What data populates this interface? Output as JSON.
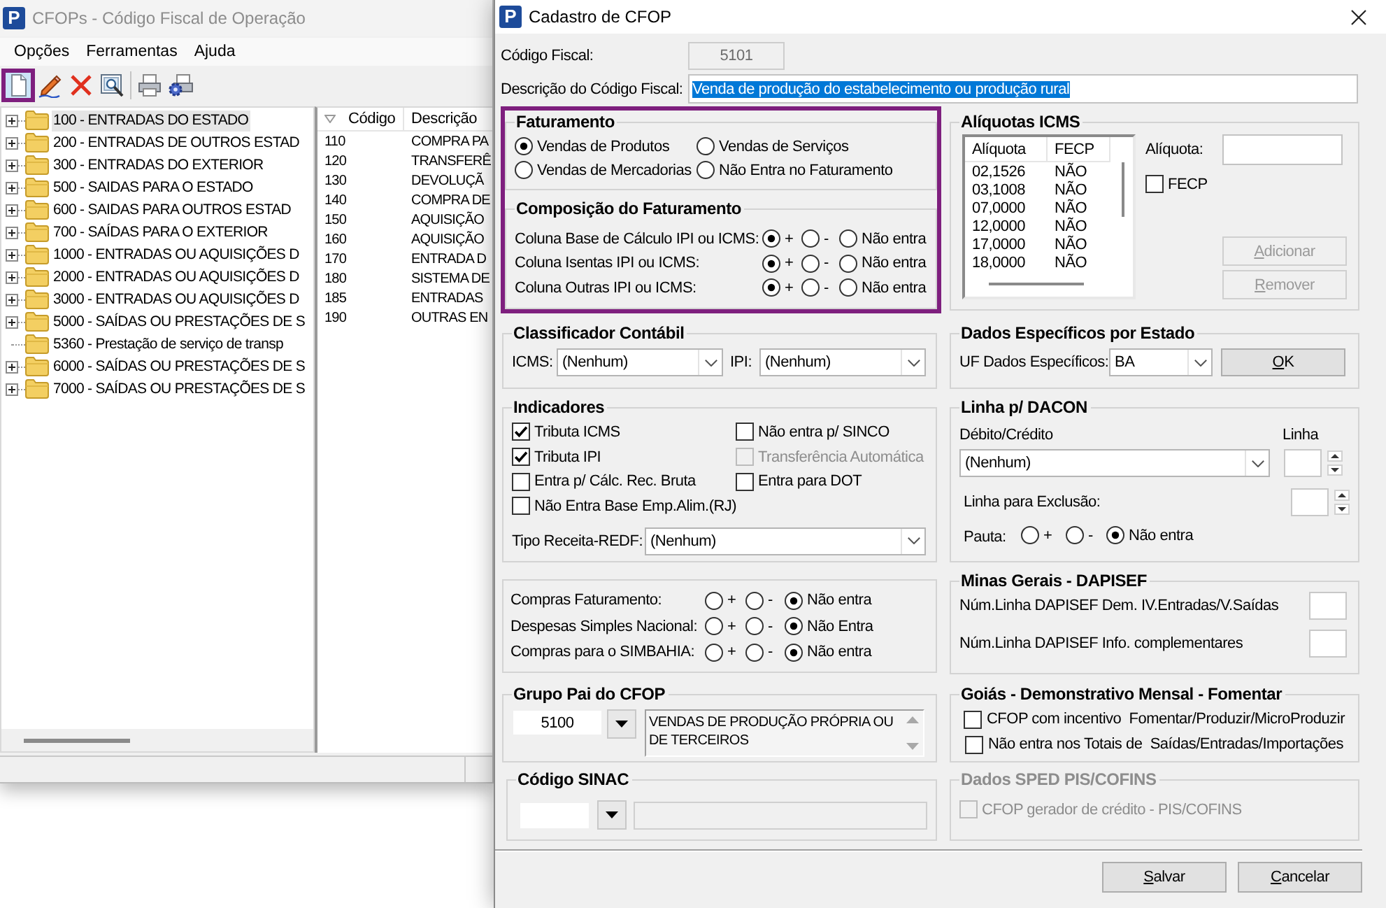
{
  "main_window": {
    "logo": "P",
    "title": "CFOPs - Código Fiscal de Operação",
    "menu": [
      {
        "label": "Opções"
      },
      {
        "label": "Ferramentas"
      },
      {
        "label": "Ajuda"
      }
    ],
    "toolbar": [
      {
        "kind": "new",
        "highlighted": true
      },
      {
        "kind": "edit",
        "highlighted": false
      },
      {
        "kind": "delete",
        "highlighted": false
      },
      {
        "kind": "find",
        "highlighted": false
      },
      {
        "kind": "separator"
      },
      {
        "kind": "print",
        "highlighted": false
      },
      {
        "kind": "print_setup",
        "highlighted": false
      }
    ],
    "tree": [
      {
        "label": "100 - ENTRADAS DO ESTADO",
        "expandable": true,
        "selected": true
      },
      {
        "label": "200 - ENTRADAS DE OUTROS ESTAD",
        "expandable": true,
        "selected": false
      },
      {
        "label": "300 - ENTRADAS DO EXTERIOR",
        "expandable": true,
        "selected": false
      },
      {
        "label": "500 - SAIDAS PARA O ESTADO",
        "expandable": true,
        "selected": false
      },
      {
        "label": "600 - SAIDAS PARA OUTROS ESTAD",
        "expandable": true,
        "selected": false
      },
      {
        "label": "700 - SAÍDAS PARA O EXTERIOR",
        "expandable": true,
        "selected": false
      },
      {
        "label": "1000 - ENTRADAS OU AQUISIÇÕES D",
        "expandable": true,
        "selected": false
      },
      {
        "label": "2000 - ENTRADAS OU AQUISIÇÕES D",
        "expandable": true,
        "selected": false
      },
      {
        "label": "3000 - ENTRADAS OU AQUISIÇÕES D",
        "expandable": true,
        "selected": false
      },
      {
        "label": "5000 - SAÍDAS OU PRESTAÇÕES DE S",
        "expandable": true,
        "selected": false
      },
      {
        "label": "5360 - Prestação de serviço de transp",
        "expandable": false,
        "selected": false
      },
      {
        "label": "6000 - SAÍDAS OU PRESTAÇÕES DE S",
        "expandable": true,
        "selected": false
      },
      {
        "label": "7000 - SAÍDAS OU PRESTAÇÕES DE S",
        "expandable": true,
        "selected": false
      }
    ],
    "list": {
      "columns": [
        {
          "label": "Código",
          "sorted": true
        },
        {
          "label": "Descrição",
          "sorted": false
        }
      ],
      "rows": [
        {
          "code": "110",
          "description": "COMPRA PA"
        },
        {
          "code": "120",
          "description": "TRANSFERÊ"
        },
        {
          "code": "130",
          "description": "DEVOLUÇÃ"
        },
        {
          "code": "140",
          "description": "COMPRA DE"
        },
        {
          "code": "150",
          "description": "AQUISIÇÃO"
        },
        {
          "code": "160",
          "description": "AQUISIÇÃO"
        },
        {
          "code": "170",
          "description": "ENTRADA D"
        },
        {
          "code": "180",
          "description": "SISTEMA DE"
        },
        {
          "code": "185",
          "description": "ENTRADAS"
        },
        {
          "code": "190",
          "description": "OUTRAS EN"
        }
      ]
    }
  },
  "dialog": {
    "logo": "P",
    "title": "Cadastro de CFOP",
    "codigo_fiscal": {
      "label": "Código Fiscal:",
      "value": "5101",
      "disabled": true
    },
    "descricao": {
      "label": "Descrição do Código Fiscal:",
      "value": "Venda de produção do estabelecimento ou produção rural",
      "text_selected": true
    },
    "fiscal_section": {
      "highlighted": true,
      "faturamento": {
        "title": "Faturamento",
        "options": [
          {
            "label": "Vendas de Produtos",
            "selected": true
          },
          {
            "label": "Vendas de Serviços",
            "selected": false
          },
          {
            "label": "Vendas de Mercadorias",
            "selected": false
          },
          {
            "label": "Não Entra no Faturamento",
            "selected": false
          }
        ]
      },
      "composicao": {
        "title": "Composição do Faturamento",
        "rows": [
          {
            "label": "Coluna Base de Cálculo IPI ou ICMS:",
            "options": [
              {
                "label": "+",
                "selected": true
              },
              {
                "label": "-",
                "selected": false
              },
              {
                "label": "Não entra",
                "selected": false
              }
            ]
          },
          {
            "label": "Coluna Isentas IPI ou ICMS:",
            "options": [
              {
                "label": "+",
                "selected": true
              },
              {
                "label": "-",
                "selected": false
              },
              {
                "label": "Não entra",
                "selected": false
              }
            ]
          },
          {
            "label": "Coluna Outras IPI ou ICMS:",
            "options": [
              {
                "label": "+",
                "selected": true
              },
              {
                "label": "-",
                "selected": false
              },
              {
                "label": "Não entra",
                "selected": false
              }
            ]
          }
        ]
      }
    },
    "aliquotas": {
      "title": "Alíquotas ICMS",
      "columns": [
        "Alíquota",
        "FECP"
      ],
      "rows": [
        [
          "02,1526",
          "NÃO"
        ],
        [
          "03,1008",
          "NÃO"
        ],
        [
          "07,0000",
          "NÃO"
        ],
        [
          "12,0000",
          "NÃO"
        ],
        [
          "17,0000",
          "NÃO"
        ],
        [
          "18,0000",
          "NÃO"
        ]
      ],
      "aliquota_label": "Alíquota:",
      "fecp": {
        "label": "FECP",
        "checked": false
      },
      "buttons": [
        {
          "label": "Adicionar",
          "disabled": true
        },
        {
          "label": "Remover",
          "disabled": true
        }
      ]
    },
    "classificador": {
      "title": "Classificador Contábil",
      "fields": [
        {
          "label": "ICMS:",
          "value": "(Nenhum)"
        },
        {
          "label": "IPI:",
          "value": "(Nenhum)"
        }
      ]
    },
    "dados_estado": {
      "title": "Dados Específicos por Estado",
      "label": "UF Dados Específicos:",
      "value": "BA",
      "button": "OK"
    },
    "indicadores": {
      "title": "Indicadores",
      "checks": [
        {
          "label": "Tributa ICMS",
          "checked": true,
          "disabled": false
        },
        {
          "label": "Não entra p/ SINCO",
          "checked": false,
          "disabled": false
        },
        {
          "label": "Tributa IPI",
          "checked": true,
          "disabled": false
        },
        {
          "label": "Transferência Automática",
          "checked": false,
          "disabled": true
        },
        {
          "label": "Entra p/ Cálc. Rec. Bruta",
          "checked": false,
          "disabled": false
        },
        {
          "label": "Entra para DOT",
          "checked": false,
          "disabled": false
        },
        {
          "label": "Não Entra Base Emp.Alim.(RJ)",
          "checked": false,
          "disabled": false
        }
      ],
      "tipo_receita": {
        "label": "Tipo Receita-REDF:",
        "value": "(Nenhum)"
      }
    },
    "dacon": {
      "title": "Linha p/ DACON",
      "debito_label": "Débito/Crédito",
      "linha_label": "Linha",
      "debito_value": "(Nenhum)",
      "exclusao_label": "Linha para Exclusão:",
      "pauta": {
        "label": "Pauta:",
        "options": [
          {
            "label": "+",
            "selected": false
          },
          {
            "label": "-",
            "selected": false
          },
          {
            "label": "Não entra",
            "selected": true
          }
        ]
      }
    },
    "compras": {
      "rows": [
        {
          "label": "Compras Faturamento:",
          "options": [
            {
              "label": "+",
              "selected": false
            },
            {
              "label": "-",
              "selected": false
            },
            {
              "label": "Não entra",
              "selected": true
            }
          ]
        },
        {
          "label": "Despesas Simples Nacional:",
          "options": [
            {
              "label": "+",
              "selected": false
            },
            {
              "label": "-",
              "selected": false
            },
            {
              "label": "Não Entra",
              "selected": true
            }
          ]
        },
        {
          "label": "Compras para o SIMBAHIA:",
          "options": [
            {
              "label": "+",
              "selected": false
            },
            {
              "label": "-",
              "selected": false
            },
            {
              "label": "Não entra",
              "selected": true
            }
          ]
        }
      ]
    },
    "minas": {
      "title": "Minas Gerais - DAPISEF",
      "fields": [
        {
          "label": "Núm.Linha DAPISEF Dem. IV.Entradas/V.Saídas"
        },
        {
          "label": "Núm.Linha DAPISEF Info. complementares"
        }
      ]
    },
    "grupo_pai": {
      "title": "Grupo Pai do CFOP",
      "code": "5100",
      "description": "VENDAS DE PRODUÇÃO PRÓPRIA OU DE TERCEIROS"
    },
    "goias": {
      "title": "Goiás - Demonstrativo Mensal - Fomentar",
      "checks": [
        {
          "label": "CFOP com incentivo  Fomentar/Produzir/MicroProduzir",
          "checked": false,
          "disabled": false
        },
        {
          "label": "Não entra nos Totais de  Saídas/Entradas/Importações",
          "checked": false,
          "disabled": false
        }
      ]
    },
    "sinac": {
      "title": "Código SINAC"
    },
    "sped": {
      "title": "Dados SPED PIS/COFINS",
      "disabled": true,
      "checks": [
        {
          "label": "CFOP gerador de crédito - PIS/COFINS",
          "checked": false,
          "disabled": true
        }
      ]
    },
    "buttons": [
      {
        "label": "Salvar"
      },
      {
        "label": "Cancelar"
      }
    ]
  }
}
